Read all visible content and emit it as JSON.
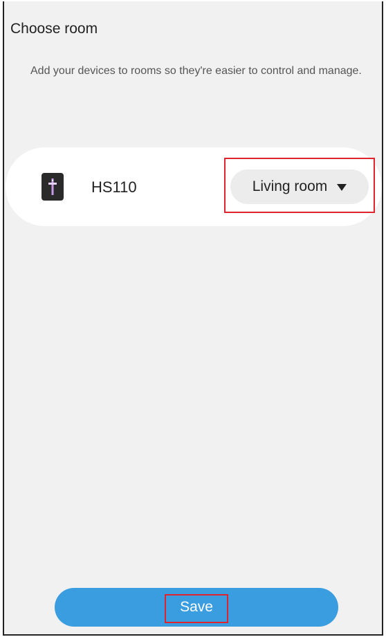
{
  "header": {
    "title": "Choose room"
  },
  "description": "Add your devices to rooms so they're easier to control and manage.",
  "device": {
    "name": "HS110",
    "icon": "smart-plug-icon",
    "room": "Living room"
  },
  "footer": {
    "save_label": "Save"
  },
  "colors": {
    "accent": "#3a9de0",
    "highlight": "#e0242e",
    "background": "#f1f1f1"
  }
}
